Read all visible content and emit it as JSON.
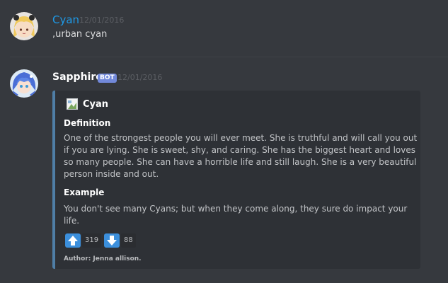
{
  "messages": [
    {
      "author": "Cyan",
      "author_color": "#1e9ae8",
      "timestamp": "12/01/2016",
      "content": ",urban cyan",
      "avatar_icon": "anime-girl-avatar-icon"
    },
    {
      "author": "Sapphire",
      "author_color": "#ffffff",
      "bot_tag": "BOT",
      "timestamp": "12/01/2016",
      "avatar_icon": "anime-girl-blue-hair-avatar-icon",
      "embed": {
        "color": "#4f7ea6",
        "author": "Cyan",
        "thumbnail_icon": "broken-image-icon",
        "fields": [
          {
            "name": "Definition",
            "value": "One of the strongest people you will ever meet. She is truthful and will call you out if you are lying. She is sweet, shy, and caring. She has the biggest heart and loves so many people. She can have a horrible life and still laugh. She is a very beautiful person inside and out."
          },
          {
            "name": "Example",
            "value": "You don't see many Cyans; but when they come along, they sure do impact your life."
          }
        ],
        "reactions": [
          {
            "icon": "arrow-up-icon",
            "count": "319"
          },
          {
            "icon": "arrow-down-icon",
            "count": "88"
          }
        ],
        "footer": "Author: Jenna allison."
      }
    }
  ]
}
